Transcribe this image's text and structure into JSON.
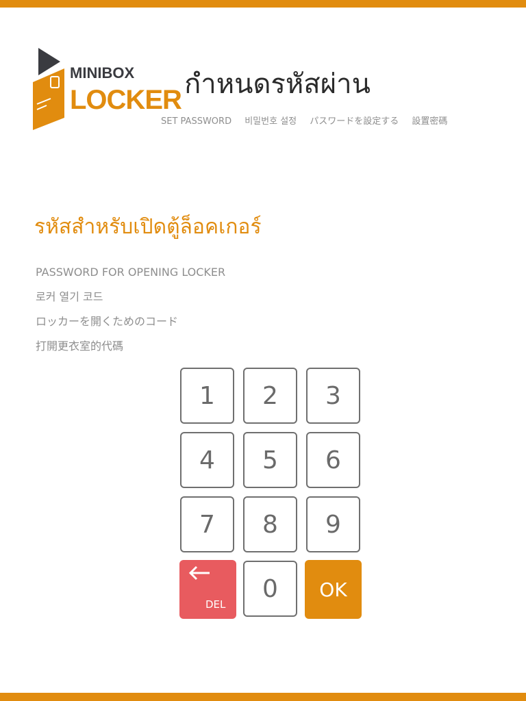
{
  "logo": {
    "line1": "MINIBOX",
    "line2": "LOCKER"
  },
  "header": {
    "title": "กำหนดรหัสผ่าน",
    "subtitles": [
      "SET PASSWORD",
      "비밀번호 설정",
      "パスワードを設定する",
      "設置密碼"
    ]
  },
  "section": {
    "heading": "รหัสสำหรับเปิดตู้ล็อคเกอร์",
    "descriptions": [
      "PASSWORD FOR OPENING LOCKER",
      "로커 열기 코드",
      "ロッカーを開くためのコード",
      "打開更衣室的代碼"
    ]
  },
  "keypad": {
    "keys": [
      "1",
      "2",
      "3",
      "4",
      "5",
      "6",
      "7",
      "8",
      "9"
    ],
    "zero": "0",
    "del_label": "DEL",
    "ok_label": "OK"
  },
  "colors": {
    "accent": "#e18c0f",
    "delete": "#e85b5f",
    "dark": "#3a3b40",
    "text_gray": "#8e8e8e"
  }
}
